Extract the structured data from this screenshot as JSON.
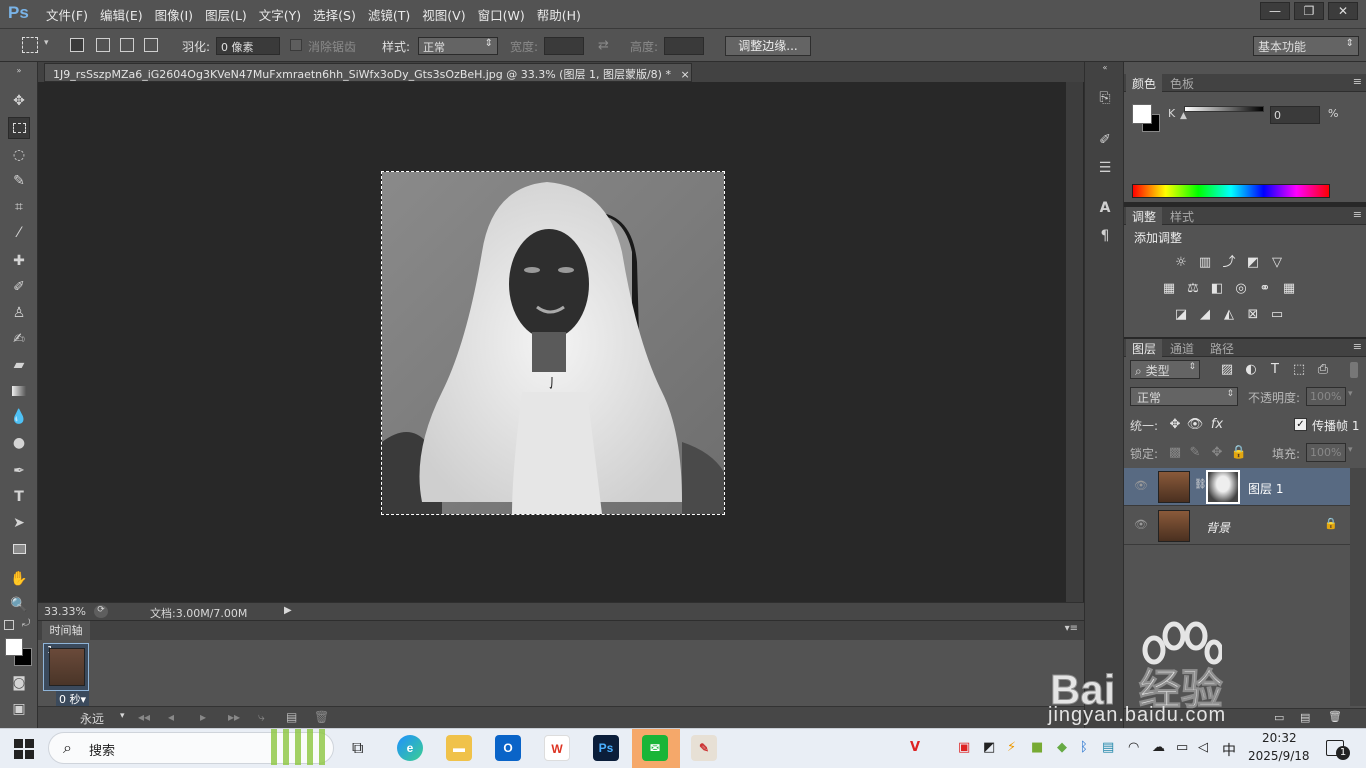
{
  "app": {
    "logo": "Ps"
  },
  "menu": [
    "文件(F)",
    "编辑(E)",
    "图像(I)",
    "图层(L)",
    "文字(Y)",
    "选择(S)",
    "滤镜(T)",
    "视图(V)",
    "窗口(W)",
    "帮助(H)"
  ],
  "window_controls": [
    "—",
    "❐",
    "✕"
  ],
  "options": {
    "feather_label": "羽化:",
    "feather_value": "0 像素",
    "antialias_label": "消除锯齿",
    "style_label": "样式:",
    "style_value": "正常",
    "width_label": "宽度:",
    "height_label": "高度:",
    "refine_button": "调整边缘...",
    "workspace": "基本功能"
  },
  "document": {
    "tab_title": "1J9_rsSszpMZa6_iG2604Og3KVeN47MuFxmraetn6hh_SiWfx3oDy_Gts3sOzBeH.jpg @ 33.3% (图层 1, 图层蒙版/8) *",
    "tab_close": "×"
  },
  "status": {
    "zoom": "33.33%",
    "doc_info": "文档:3.00M/7.00M"
  },
  "timeline": {
    "tab": "时间轴",
    "frame_number": "1",
    "frame_delay": "0 秒▾",
    "loop": "永远"
  },
  "color_panel": {
    "tabs": [
      "颜色",
      "色板"
    ],
    "channel": "K",
    "value": "0",
    "unit": "%"
  },
  "adjustments_panel": {
    "tabs": [
      "调整",
      "样式"
    ],
    "title": "添加调整"
  },
  "layers_panel": {
    "tabs": [
      "图层",
      "通道",
      "路径"
    ],
    "filter_kind": "类型",
    "blend_mode": "正常",
    "opacity_label": "不透明度:",
    "opacity_value": "100%",
    "unify_label": "统一:",
    "propagate_label": "传播帧 1",
    "lock_label": "锁定:",
    "fill_label": "填充:",
    "fill_value": "100%",
    "layers": [
      {
        "name": "图层 1",
        "selected": true
      },
      {
        "name": "背景",
        "selected": false
      }
    ]
  },
  "taskbar": {
    "search_label": "搜索",
    "ime": "中",
    "time": "20:32",
    "date": "2025/9/18",
    "notification_count": "1"
  },
  "watermark": {
    "brand": "Bai  经验",
    "url": "jingyan.baidu.com"
  }
}
